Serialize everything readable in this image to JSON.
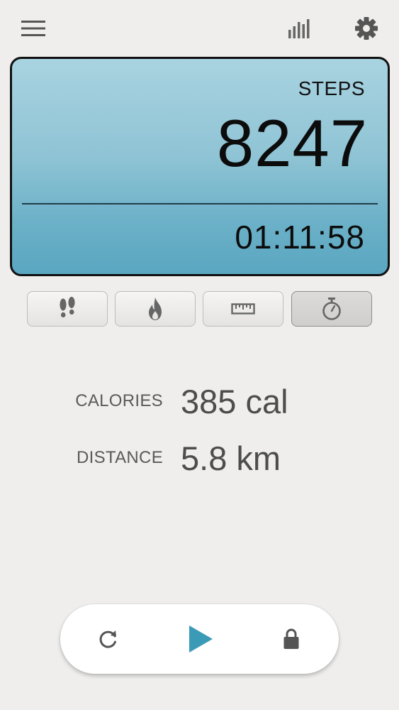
{
  "topbar": {
    "icons": [
      "menu-icon",
      "bar-chart-icon",
      "gear-icon"
    ]
  },
  "display": {
    "steps_label": "STEPS",
    "steps_value": "8247",
    "timer_value": "01:11:58",
    "accent_top": "#a9d3e0",
    "accent_bottom": "#5aa6c0"
  },
  "modes": {
    "items": [
      "footprints-icon",
      "flame-icon",
      "ruler-icon",
      "stopwatch-icon"
    ],
    "active": "stopwatch-icon"
  },
  "stats": {
    "calories_label": "CALORIES",
    "calories_value": "385 cal",
    "distance_label": "DISTANCE",
    "distance_value": "5.8 km"
  },
  "controls": {
    "icons": [
      "reset-icon",
      "play-icon",
      "lock-icon"
    ],
    "play_color": "#3b9bb6"
  }
}
